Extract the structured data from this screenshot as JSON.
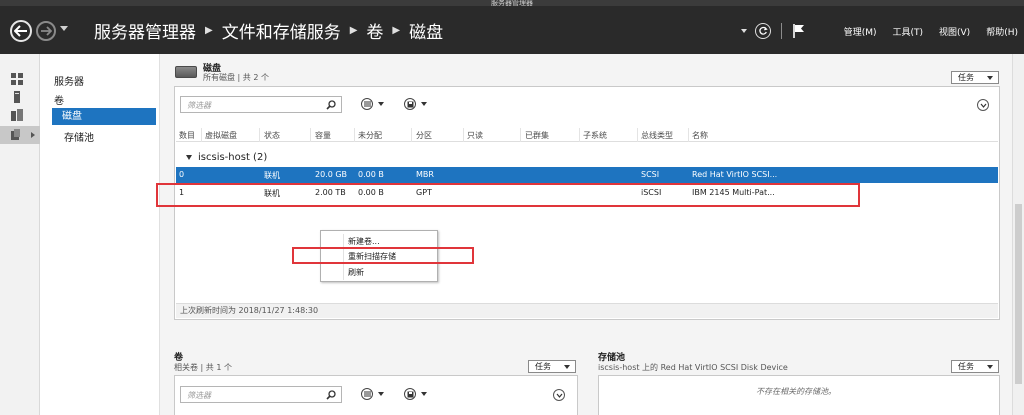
{
  "window": {
    "title": "服务器管理器"
  },
  "header": {
    "breadcrumb": [
      "服务器管理器",
      "文件和存储服务",
      "卷",
      "磁盘"
    ],
    "menus": [
      "管理(M)",
      "工具(T)",
      "视图(V)",
      "帮助(H)"
    ]
  },
  "nav": {
    "items": [
      "服务器",
      "卷",
      "磁盘",
      "存储池"
    ],
    "selected": "磁盘"
  },
  "disks": {
    "title": "磁盘",
    "subtitle": "所有磁盘 | 共 2 个",
    "tasks_label": "任务",
    "filter_placeholder": "筛选器",
    "columns": [
      "数目",
      "虚拟磁盘",
      "状态",
      "容量",
      "未分配",
      "分区",
      "只读",
      "已群集",
      "子系统",
      "总线类型",
      "名称"
    ],
    "group_label": "iscsis-host (2)",
    "rows": [
      {
        "number": "0",
        "virtual": "",
        "status": "联机",
        "capacity": "20.0 GB",
        "unallocated": "0.00 B",
        "partition": "MBR",
        "readonly": "",
        "clustered": "",
        "subsystem": "",
        "bus": "SCSI",
        "name": "Red Hat VirtIO SCSI..."
      },
      {
        "number": "1",
        "virtual": "",
        "status": "联机",
        "capacity": "2.00 TB",
        "unallocated": "0.00 B",
        "partition": "GPT",
        "readonly": "",
        "clustered": "",
        "subsystem": "",
        "bus": "iSCSI",
        "name": "IBM 2145  Multi-Pat..."
      }
    ],
    "last_refresh": "上次刷新时间为 2018/11/27 1:48:30"
  },
  "context_menu": {
    "items": [
      "新建卷...",
      "重新扫描存储",
      "刷新"
    ]
  },
  "volumes": {
    "title": "卷",
    "subtitle": "相关卷 | 共 1 个",
    "tasks_label": "任务",
    "filter_placeholder": "筛选器"
  },
  "storage_pool": {
    "title": "存储池",
    "subtitle": "iscsis-host 上的 Red Hat VirtIO SCSI Disk Device",
    "tasks_label": "任务",
    "empty_text": "不存在相关的存储池。"
  },
  "colors": {
    "header_bg": "#2a2a2a",
    "selection": "#1e74c0",
    "annotation_red": "#e0353a"
  }
}
